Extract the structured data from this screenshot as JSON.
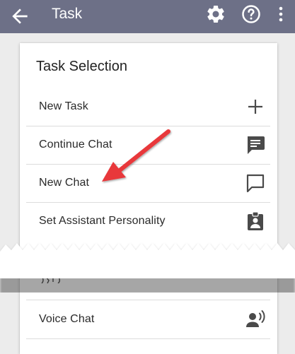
{
  "appbar": {
    "title": "Task",
    "back_icon": "arrow-left-icon",
    "settings_icon": "gear-icon",
    "help_icon": "help-circle-icon",
    "more_icon": "more-vertical-icon",
    "color": "#6d7087"
  },
  "card": {
    "title": "Task Selection",
    "items": [
      {
        "label": "New Task",
        "icon": "plus-icon"
      },
      {
        "label": "Continue Chat",
        "icon": "chat-filled-icon"
      },
      {
        "label": "New Chat",
        "icon": "chat-outline-icon"
      },
      {
        "label": "Set Assistant Personality",
        "icon": "clipboard-account-icon"
      },
      {
        "label": "Voice Chat",
        "icon": "voice-speaker-icon"
      }
    ]
  },
  "annotation": {
    "arrow_color": "#e8373a",
    "arrow_target": "New Chat"
  },
  "colors": {
    "background": "#ececec",
    "card": "#ffffff",
    "icon": "#4a4a4a",
    "divider": "#dcdcdc"
  }
}
